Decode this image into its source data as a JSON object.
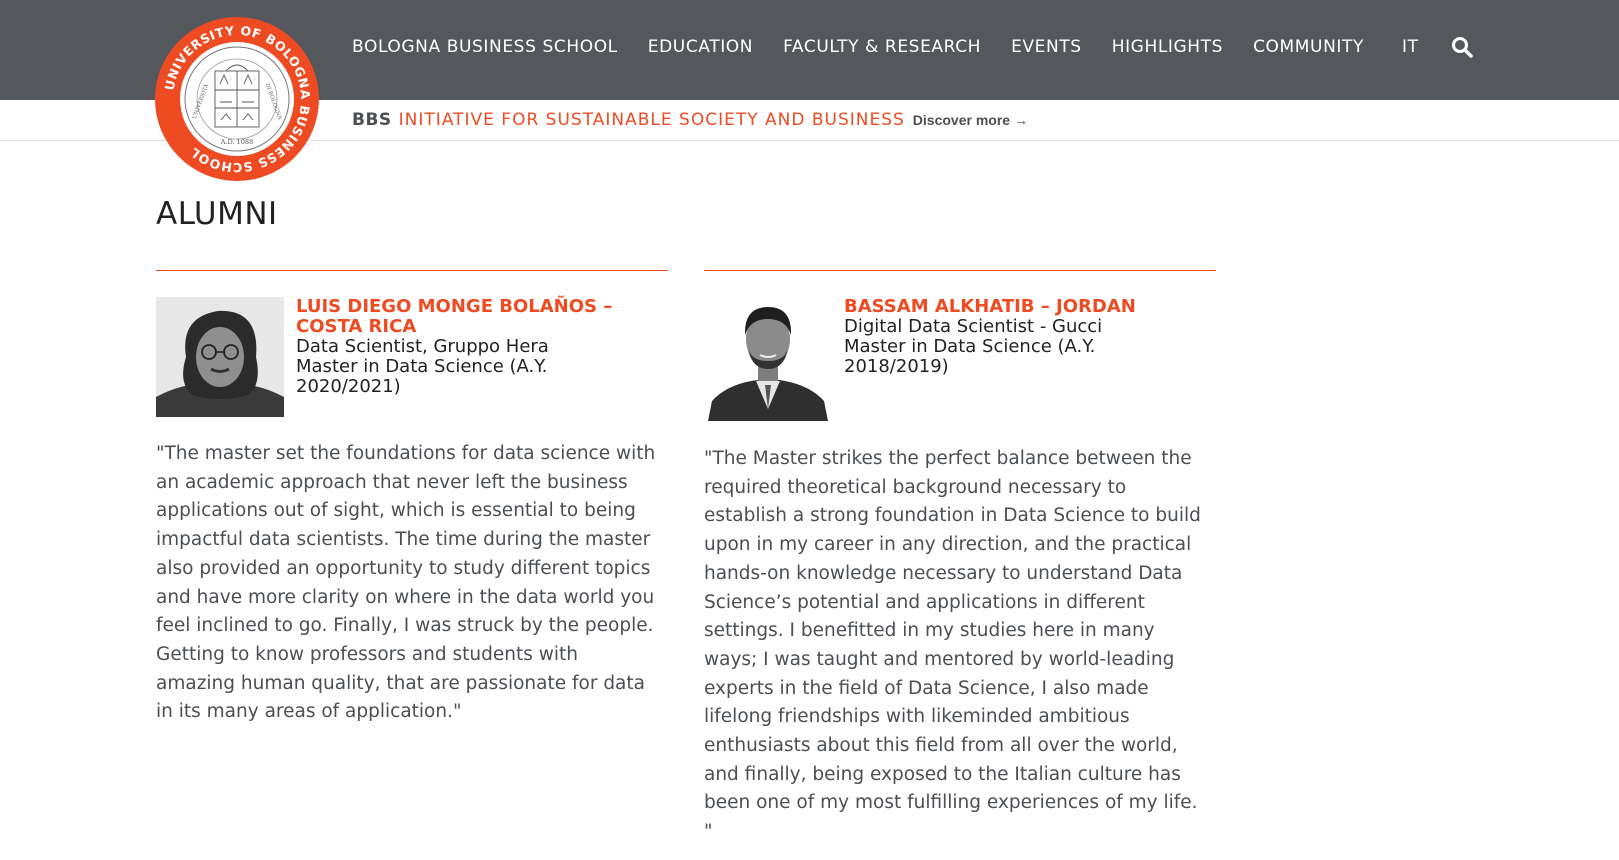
{
  "logo": {
    "ring_text": "UNIVERSITY OF BOLOGNA BUSINESS SCHOOL",
    "seal_inner_left": "UNIVERSITÀ",
    "seal_inner_right": "DI BOLOGNA",
    "seal_year": "A.D. 1088",
    "accent": "#ee4b22"
  },
  "nav": {
    "items": [
      {
        "label": "BOLOGNA BUSINESS SCHOOL"
      },
      {
        "label": "EDUCATION"
      },
      {
        "label": "FACULTY & RESEARCH"
      },
      {
        "label": "EVENTS"
      },
      {
        "label": "HIGHLIGHTS"
      },
      {
        "label": "COMMUNITY"
      }
    ],
    "lang": "IT",
    "search_icon": "search-icon"
  },
  "subbar": {
    "prefix": "BBS",
    "initiative": "INITIATIVE FOR SUSTAINABLE SOCIETY AND BUSINESS",
    "link": "Discover more →"
  },
  "page": {
    "title": "ALUMNI"
  },
  "alumni": [
    {
      "name": "LUIS DIEGO MONGE BOLAÑOS – COSTA RICA",
      "role": "Data Scientist, Gruppo Hera",
      "program": "Master in Data Science (A.Y. 2020/2021)",
      "quote": "\"The master set the foundations for data science with an academic approach that never left the business applications out of sight, which is essential to being impactful data scientists. The time during the master also provided an opportunity to study different topics and have more clarity on where in the data world you feel inclined to go. Finally, I was struck by the people. Getting to know professors and students with amazing human quality, that are passionate for data in its many areas of application.\""
    },
    {
      "name": "BASSAM ALKHATIB – JORDAN",
      "role": "Digital Data Scientist - Gucci",
      "program": "Master in Data Science (A.Y. 2018/2019)",
      "quote": "\"The Master strikes the perfect balance between the required theoretical background necessary to establish a strong foundation in Data Science to build upon in my career in any direction, and the practical hands-on knowledge necessary to understand Data Science’s potential and applications in different settings. I benefitted in my studies here in many ways; I was taught and mentored by world-leading experts in the field of Data Science, I also made lifelong friendships with likeminded ambitious enthusiasts about this field from all over the world, and finally, being exposed to the Italian culture has been one of my most fulfilling experiences of my life. \""
    }
  ]
}
